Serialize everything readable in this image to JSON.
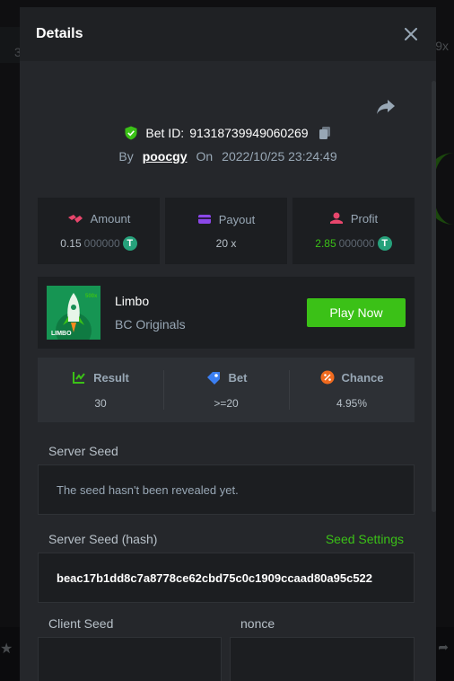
{
  "background": {
    "left_number": "3",
    "right_number": "9x"
  },
  "modal": {
    "title": "Details"
  },
  "bet": {
    "id_label": "Bet ID:",
    "id_value": "91318739949060269",
    "by_label": "By",
    "username": "poocgy",
    "on_label": "On",
    "date": "2022/10/25 23:24:49"
  },
  "stats": {
    "amount": {
      "label": "Amount",
      "value_main": "0.15",
      "value_faded": "000000",
      "coin": "T"
    },
    "payout": {
      "label": "Payout",
      "value": "20 x"
    },
    "profit": {
      "label": "Profit",
      "value_main": "2.85",
      "value_faded": "000000",
      "coin": "T"
    }
  },
  "game": {
    "name": "Limbo",
    "provider": "BC Originals",
    "thumb_text": "LIMBO",
    "thumb_badge": "500x",
    "play_label": "Play Now"
  },
  "result_stats": {
    "result": {
      "label": "Result",
      "value": "30"
    },
    "bet": {
      "label": "Bet",
      "value": ">=20"
    },
    "chance": {
      "label": "Chance",
      "value": "4.95%"
    }
  },
  "server_seed": {
    "label": "Server Seed",
    "value": "The seed hasn't been revealed yet."
  },
  "server_seed_hash": {
    "label": "Server Seed (hash)",
    "settings_link": "Seed Settings",
    "value": "beac17b1dd8c7a8778ce62cbd75c0c1909ccaad80a95c522"
  },
  "client_seed": {
    "label": "Client Seed"
  },
  "nonce": {
    "label": "nonce"
  },
  "colors": {
    "accent_green": "#3bc117",
    "tether_green": "#26a17b"
  }
}
